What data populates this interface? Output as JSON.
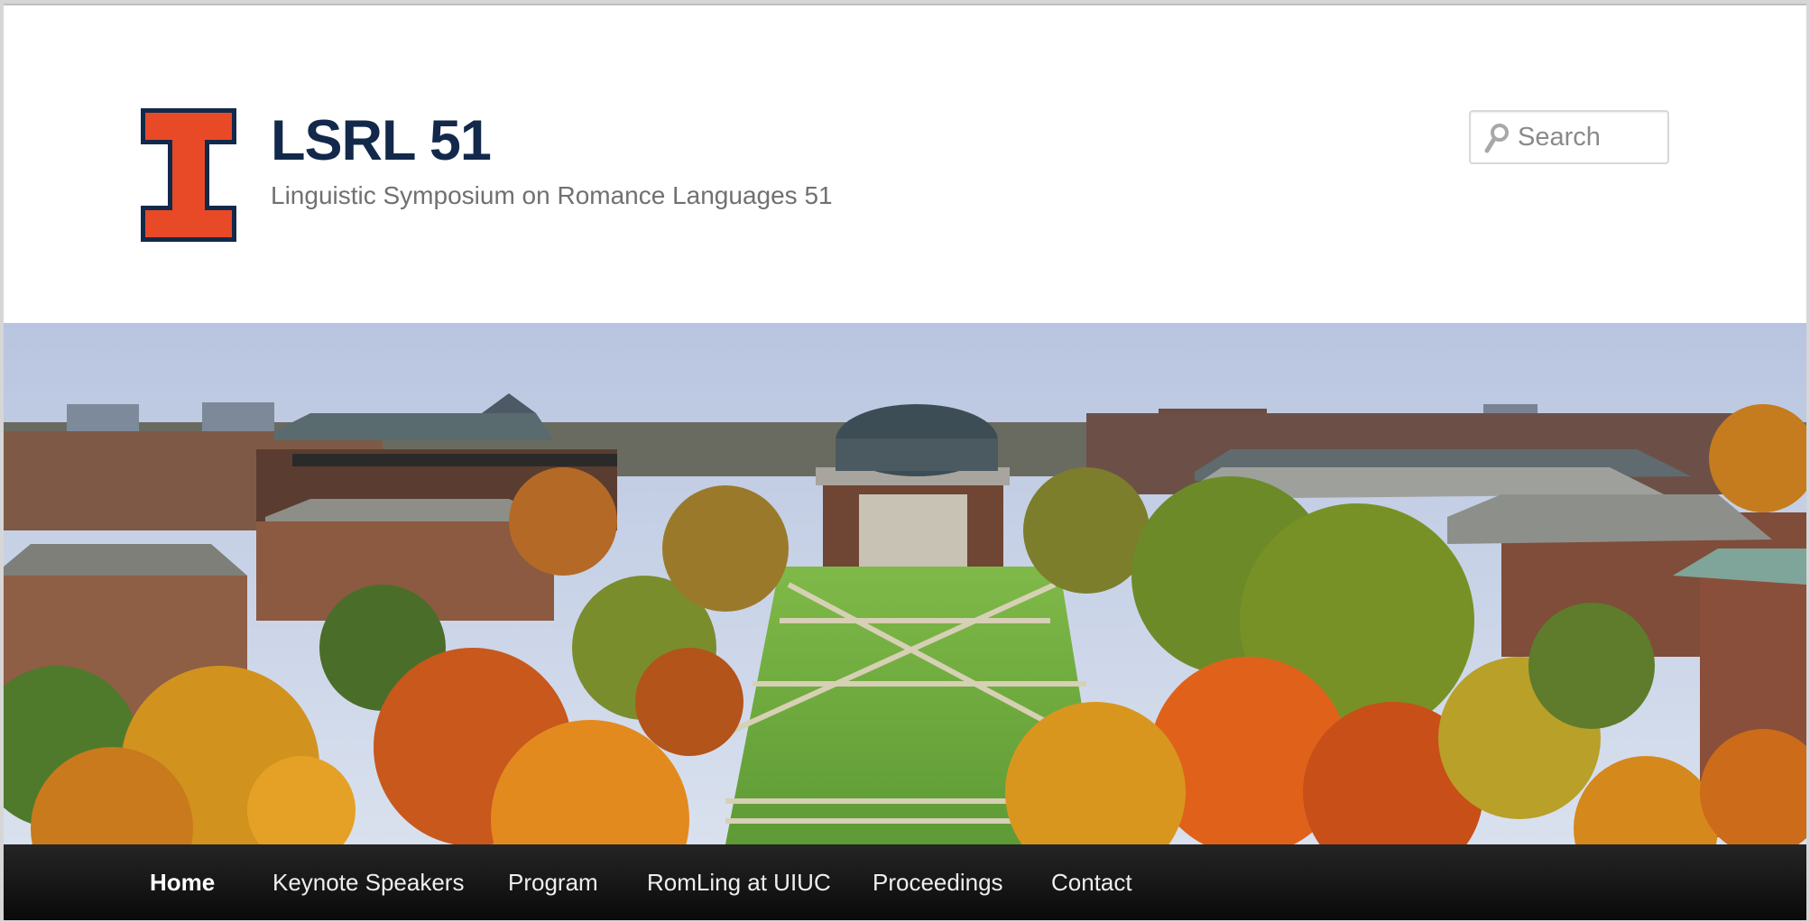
{
  "site": {
    "title": "LSRL 51",
    "description": "Linguistic Symposium on Romance Languages 51"
  },
  "search": {
    "placeholder": "Search"
  },
  "colors": {
    "title": "#13294b",
    "logo_orange": "#e84a27",
    "logo_navy": "#13294b",
    "nav_bg": "#1a1a1a"
  },
  "banner": {
    "description": "Aerial view of university quad in autumn with domed auditorium"
  },
  "nav": {
    "items": [
      {
        "label": "Home",
        "current": true
      },
      {
        "label": "Keynote Speakers"
      },
      {
        "label": "Program"
      },
      {
        "label": "RomLing at UIUC"
      },
      {
        "label": "Proceedings"
      },
      {
        "label": "Contact"
      }
    ]
  }
}
